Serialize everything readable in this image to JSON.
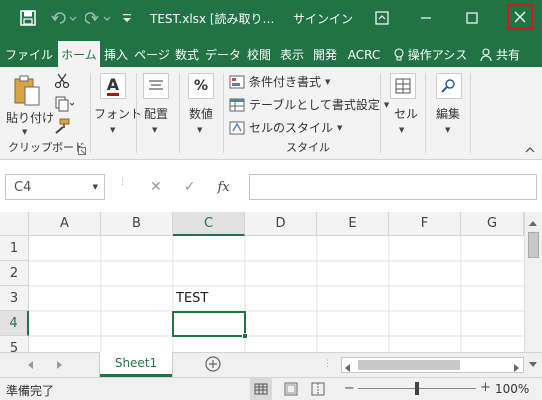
{
  "titlebar": {
    "title": "TEST.xlsx [読み取り…",
    "signin": "サインイン",
    "colors": {
      "bg": "#217346",
      "close_border": "#d9141b"
    }
  },
  "tabs": [
    {
      "label": "ファイル"
    },
    {
      "label": "ホーム"
    },
    {
      "label": "挿入"
    },
    {
      "label": "ページ"
    },
    {
      "label": "数式"
    },
    {
      "label": "データ"
    },
    {
      "label": "校閲"
    },
    {
      "label": "表示"
    },
    {
      "label": "開発"
    },
    {
      "label": "ACRC"
    }
  ],
  "tell_me": "操作アシス",
  "share": "共有",
  "ribbon": {
    "paste": "貼り付け",
    "clipboard_group": "クリップボード",
    "font": "フォント",
    "alignment": "配置",
    "number": "数値",
    "cond_format": "条件付き書式",
    "format_table": "テーブルとして書式設定",
    "cell_styles": "セルのスタイル",
    "style_group": "スタイル",
    "cells": "セル",
    "editing": "編集",
    "percent_icon": "%",
    "font_icon": "A"
  },
  "formula_bar": {
    "name_box": "C4",
    "fx": "fx",
    "value": ""
  },
  "grid": {
    "columns": [
      "A",
      "B",
      "C",
      "D",
      "E",
      "F",
      "G"
    ],
    "rows": [
      "1",
      "2",
      "3",
      "4",
      "5"
    ],
    "cell_C3": "TEST",
    "active_cell": "C4"
  },
  "sheets": {
    "active": "Sheet1"
  },
  "status": {
    "ready": "準備完了",
    "zoom": "100%"
  }
}
